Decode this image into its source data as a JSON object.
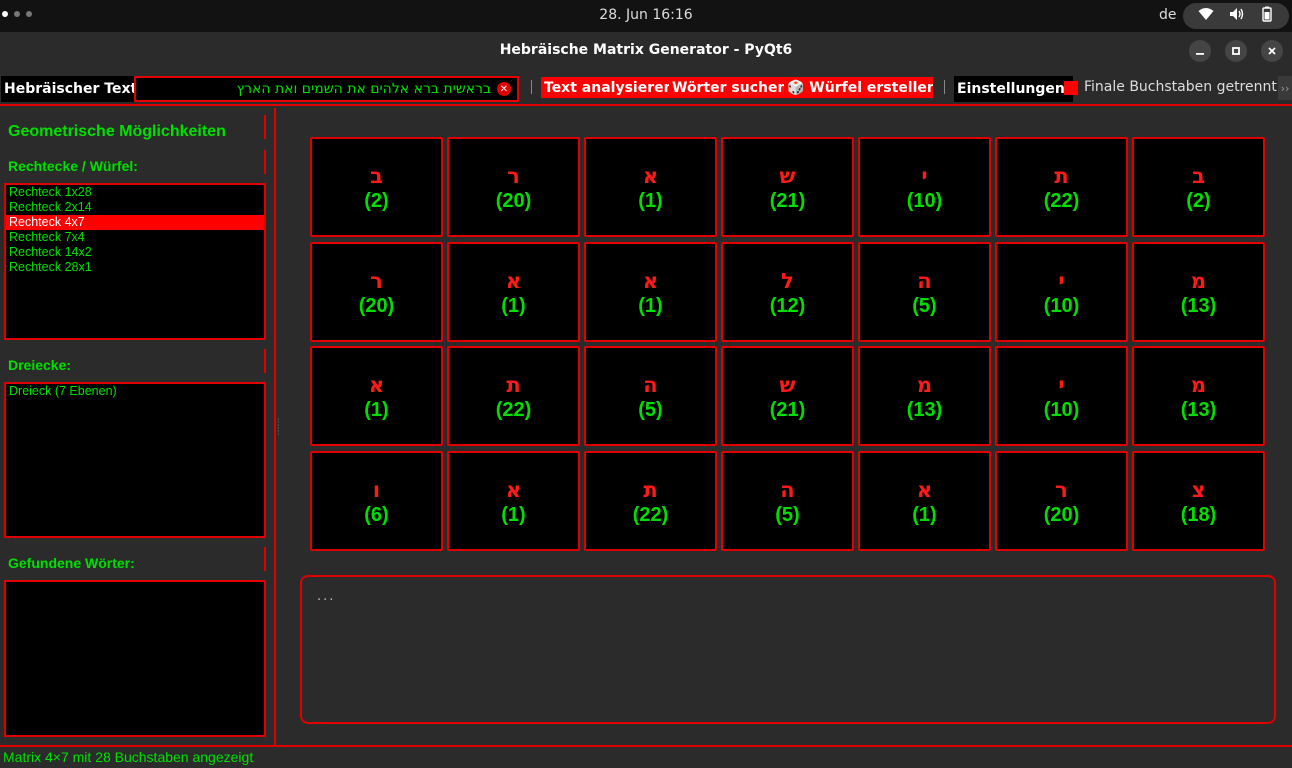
{
  "system": {
    "clock": "28. Jun  16:16",
    "lang": "de",
    "tray_icons": [
      "wifi-icon",
      "volume-icon",
      "battery-icon"
    ]
  },
  "window": {
    "title": "Hebräische Matrix Generator - PyQt6"
  },
  "toolbar": {
    "text_label": "Hebräischer Text:",
    "text_value": "בראשית ברא אלהים את השמים ואת הארץ",
    "analyze_label": "Text analysieren",
    "search_label": "Wörter suchen",
    "cube_label": "🎲 Würfel erstellen...",
    "settings_label": "Einstellungen:",
    "final_letters_label": "Finale Buchstaben getrennt"
  },
  "sidebar": {
    "title": "Geometrische Möglichkeiten",
    "rect_heading": "Rechtecke / Würfel:",
    "rectangles": [
      "Rechteck 1x28",
      "Rechteck 2x14",
      "Rechteck 4x7",
      "Rechteck 7x4",
      "Rechteck 14x2",
      "Rechteck 28x1"
    ],
    "selected_rectangle": 2,
    "tri_heading": "Dreiecke:",
    "triangles": [
      "Dreieck (7 Ebenen)"
    ],
    "words_heading": "Gefundene Wörter:",
    "words": []
  },
  "matrix": {
    "rows": 4,
    "cols": 7,
    "cells": [
      [
        {
          "l": "ב",
          "v": "(2)"
        },
        {
          "l": "ר",
          "v": "(20)"
        },
        {
          "l": "א",
          "v": "(1)"
        },
        {
          "l": "ש",
          "v": "(21)"
        },
        {
          "l": "י",
          "v": "(10)"
        },
        {
          "l": "ת",
          "v": "(22)"
        },
        {
          "l": "ב",
          "v": "(2)"
        }
      ],
      [
        {
          "l": "ר",
          "v": "(20)"
        },
        {
          "l": "א",
          "v": "(1)"
        },
        {
          "l": "א",
          "v": "(1)"
        },
        {
          "l": "ל",
          "v": "(12)"
        },
        {
          "l": "ה",
          "v": "(5)"
        },
        {
          "l": "י",
          "v": "(10)"
        },
        {
          "l": "מ",
          "v": "(13)"
        }
      ],
      [
        {
          "l": "א",
          "v": "(1)"
        },
        {
          "l": "ת",
          "v": "(22)"
        },
        {
          "l": "ה",
          "v": "(5)"
        },
        {
          "l": "ש",
          "v": "(21)"
        },
        {
          "l": "מ",
          "v": "(13)"
        },
        {
          "l": "י",
          "v": "(10)"
        },
        {
          "l": "מ",
          "v": "(13)"
        }
      ],
      [
        {
          "l": "ו",
          "v": "(6)"
        },
        {
          "l": "א",
          "v": "(1)"
        },
        {
          "l": "ת",
          "v": "(22)"
        },
        {
          "l": "ה",
          "v": "(5)"
        },
        {
          "l": "א",
          "v": "(1)"
        },
        {
          "l": "ר",
          "v": "(20)"
        },
        {
          "l": "צ",
          "v": "(18)"
        }
      ]
    ]
  },
  "output": {
    "text": "..."
  },
  "status": {
    "text": "Matrix 4×7 mit 28 Buchstaben angezeigt"
  },
  "colors": {
    "accent": "#e00000",
    "text_green": "#00e000",
    "letter_red": "#ff1a1a"
  }
}
